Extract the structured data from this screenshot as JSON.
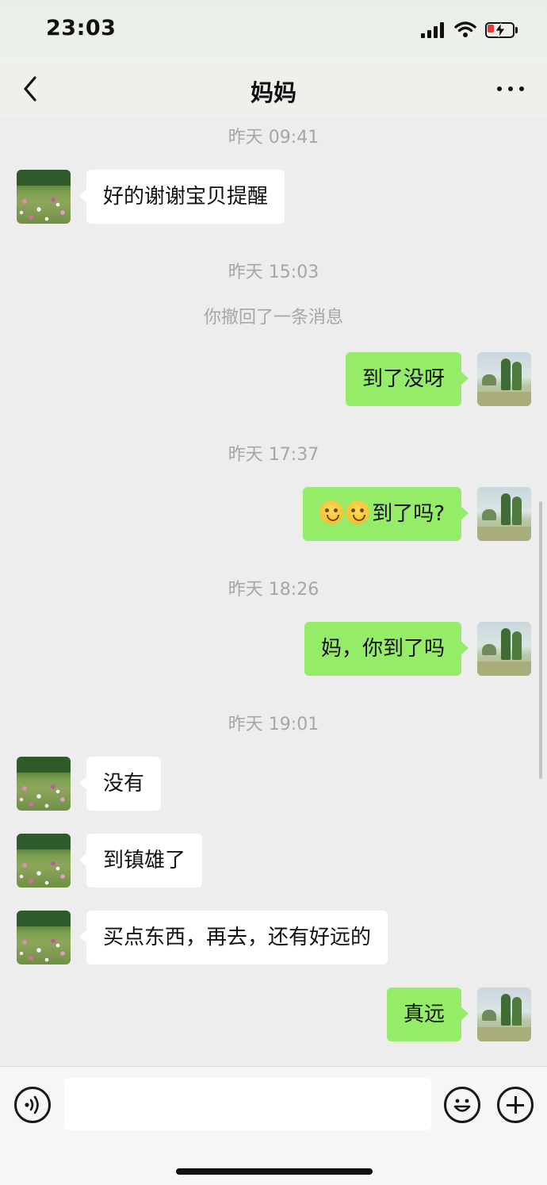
{
  "status_bar": {
    "time": "23:03",
    "icons": [
      "cellular-signal-icon",
      "wifi-icon",
      "battery-charging-icon"
    ],
    "battery_color": "#e53b3b"
  },
  "header": {
    "title": "妈妈",
    "back_icon": "chevron-left-icon",
    "more_icon": "more-dots-icon"
  },
  "messages": [
    {
      "type": "time",
      "text": "昨天 09:41"
    },
    {
      "type": "in",
      "text": "好的谢谢宝贝提醒"
    },
    {
      "type": "time",
      "text": "昨天 15:03"
    },
    {
      "type": "system",
      "text": "你撤回了一条消息"
    },
    {
      "type": "out",
      "text": "到了没呀"
    },
    {
      "type": "time",
      "text": "昨天 17:37"
    },
    {
      "type": "out",
      "text": "到了吗?",
      "emojis": [
        "crying-face-emoji",
        "crying-face-emoji"
      ]
    },
    {
      "type": "time",
      "text": "昨天 18:26"
    },
    {
      "type": "out",
      "text": "妈，你到了吗"
    },
    {
      "type": "time",
      "text": "昨天 19:01"
    },
    {
      "type": "in",
      "text": "没有"
    },
    {
      "type": "in",
      "text": "到镇雄了"
    },
    {
      "type": "in",
      "text": "买点东西，再去，还有好远的"
    },
    {
      "type": "out",
      "text": "真远"
    }
  ],
  "input_bar": {
    "value": "",
    "icons": [
      "voice-icon",
      "emoji-icon",
      "plus-icon"
    ]
  },
  "colors": {
    "sent_bubble": "#95ec69",
    "received_bubble": "#ffffff",
    "background": "#ededed",
    "timestamp_text": "#a6a6a6"
  }
}
